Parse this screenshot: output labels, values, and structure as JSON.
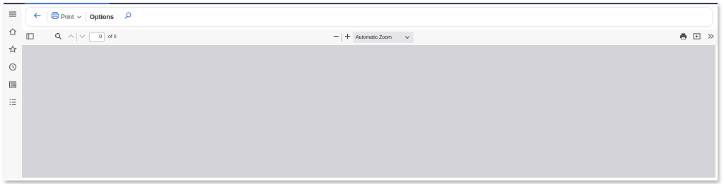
{
  "command_bar": {
    "back_icon": "back-arrow-icon",
    "print": {
      "icon": "printer-icon",
      "label": "Print"
    },
    "options_label": "Options",
    "find_icon": "search-icon"
  },
  "left_rail": {
    "items": [
      {
        "icon": "hamburger-menu-icon"
      },
      {
        "icon": "home-icon"
      },
      {
        "icon": "star-icon"
      },
      {
        "icon": "clock-icon"
      },
      {
        "icon": "newspaper-icon"
      },
      {
        "icon": "list-icon"
      }
    ]
  },
  "pdf_toolbar": {
    "page_number": "0",
    "page_count_label": "of 0",
    "zoom": {
      "selected": "Automatic Zoom"
    },
    "icons": [
      "sidebar-toggle-icon",
      "search-icon",
      "chevron-up-icon",
      "chevron-down-icon",
      "minus-icon",
      "plus-icon",
      "printer-icon",
      "save-icon",
      "double-chevron-right-icon"
    ]
  },
  "colors": {
    "accent": "#2f6fd6",
    "viewer_background": "#d4d4d8",
    "toolbar_background": "#f7f7f8"
  }
}
